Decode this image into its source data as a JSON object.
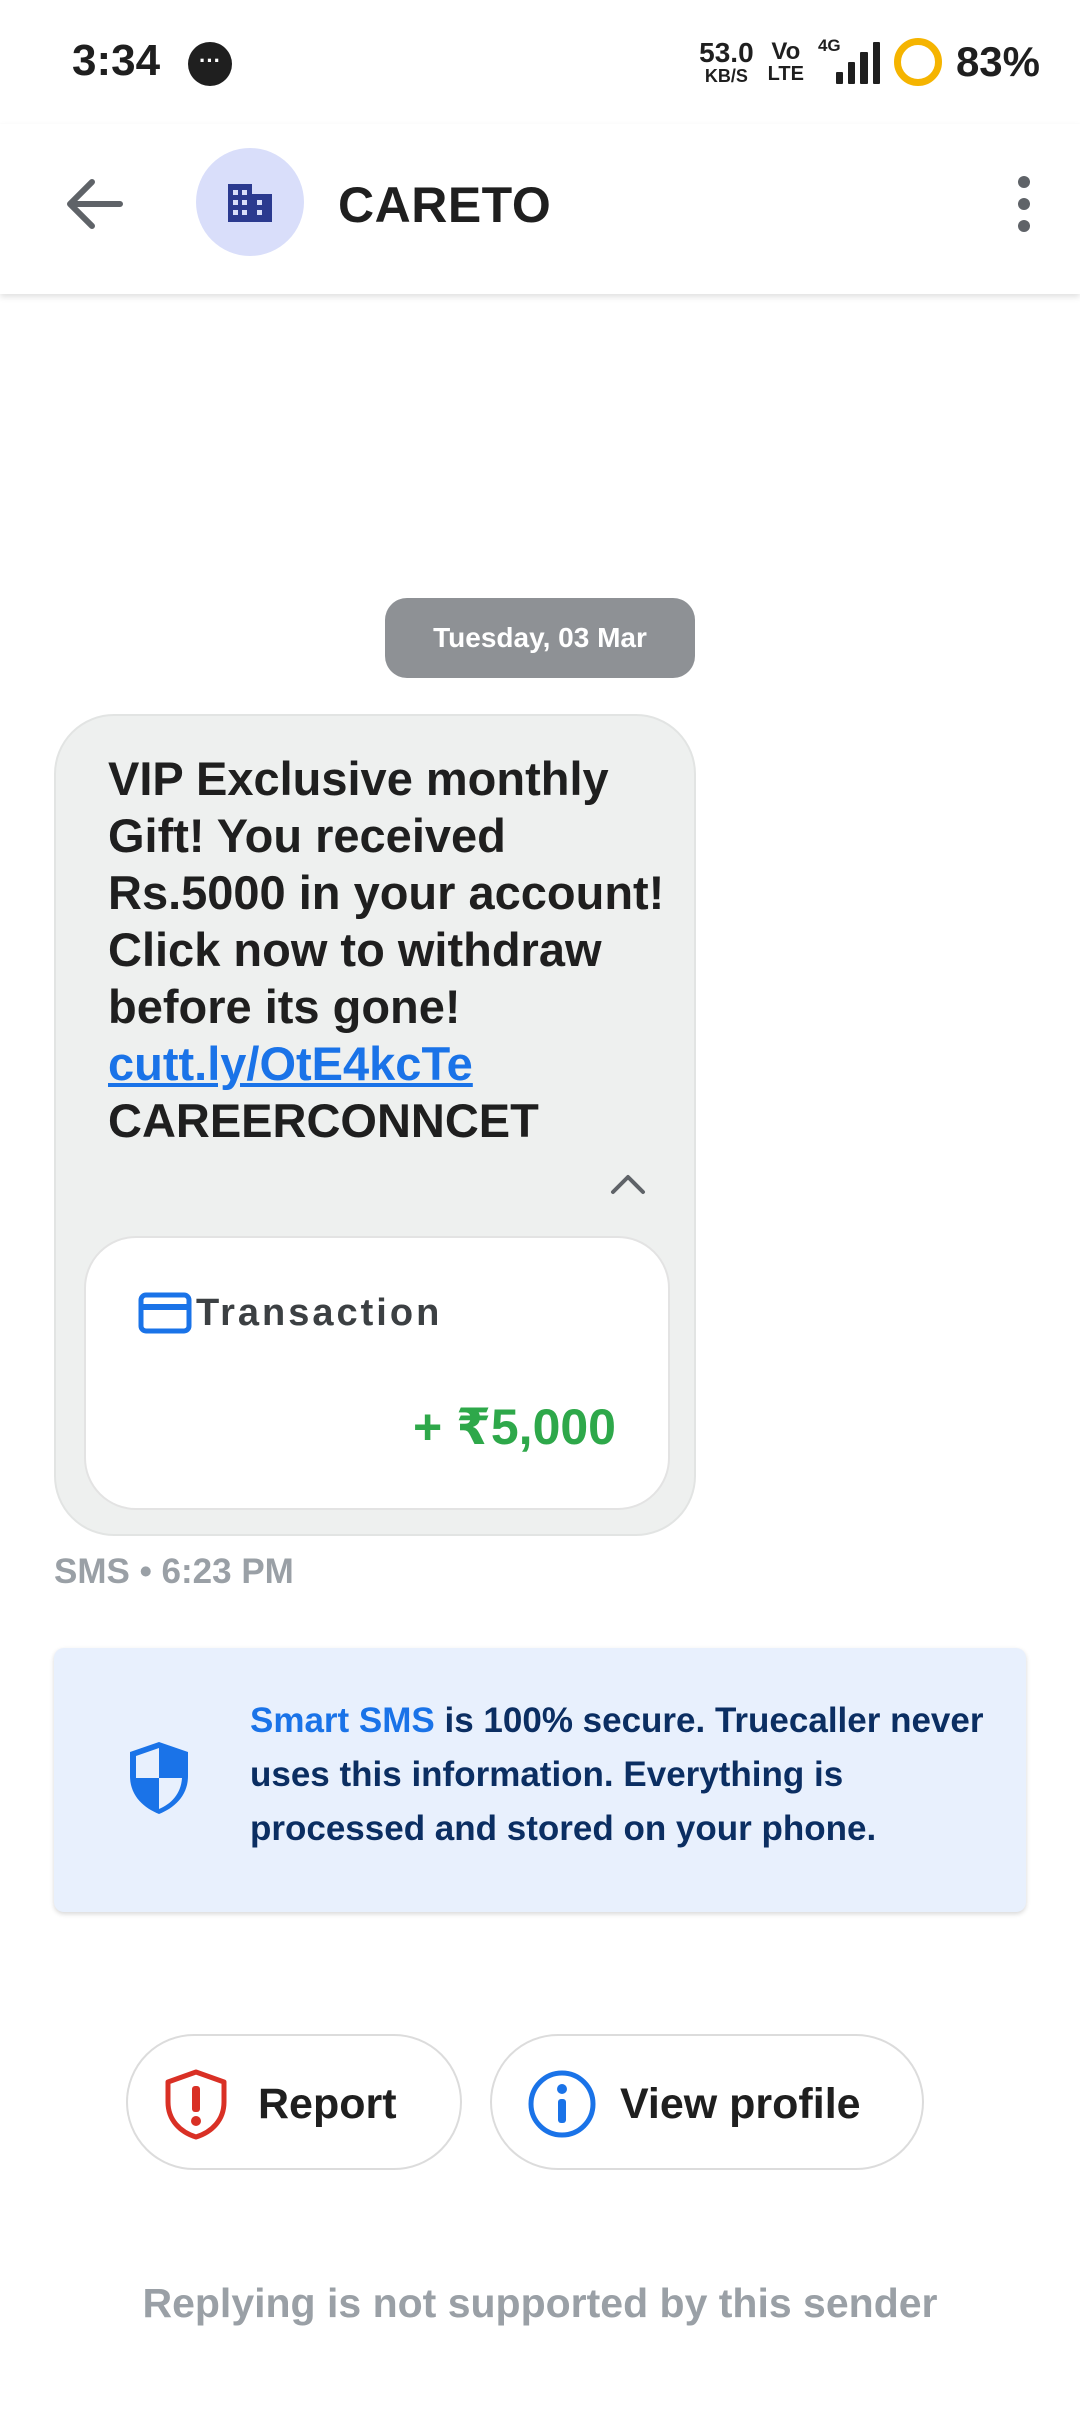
{
  "status_bar": {
    "time": "3:34",
    "net_speed_value": "53.0",
    "net_speed_unit": "KB/S",
    "volte_top": "Vo",
    "volte_bottom": "LTE",
    "network_type": "4G",
    "battery_percent": "83%",
    "battery_ring_color": "#f5b400",
    "icons": [
      "chat-bubble-icon",
      "signal-icon",
      "battery-icon"
    ]
  },
  "app_bar": {
    "sender_name": "CARETO",
    "back_icon": "arrow-left-icon",
    "avatar_icon": "building-icon",
    "menu_icon": "more-vert-icon"
  },
  "conversation": {
    "date_chip": "Tuesday, 03 Mar",
    "message": {
      "body": "VIP Exclusive monthly Gift! You received Rs.5000 in your account! Click now to withdraw before its gone!",
      "link": "cutt.ly/OtE4kcTe",
      "signature": "CAREERCONNCET",
      "transaction_label": "Transaction",
      "transaction_amount": "+ ₹5,000",
      "meta": "SMS • 6:23 PM",
      "link_color": "#1a73e8",
      "amount_color": "#2ea84a"
    }
  },
  "info_card": {
    "brand": "Smart SMS",
    "text": " is 100% secure. Truecaller never uses this information. Everything is processed and stored on your phone.",
    "icon": "shield-icon"
  },
  "actions": {
    "report_label": "Report",
    "view_profile_label": "View profile",
    "report_color": "#d93025",
    "profile_color": "#1a73e8"
  },
  "footer": {
    "note": "Replying is not supported by this sender"
  }
}
